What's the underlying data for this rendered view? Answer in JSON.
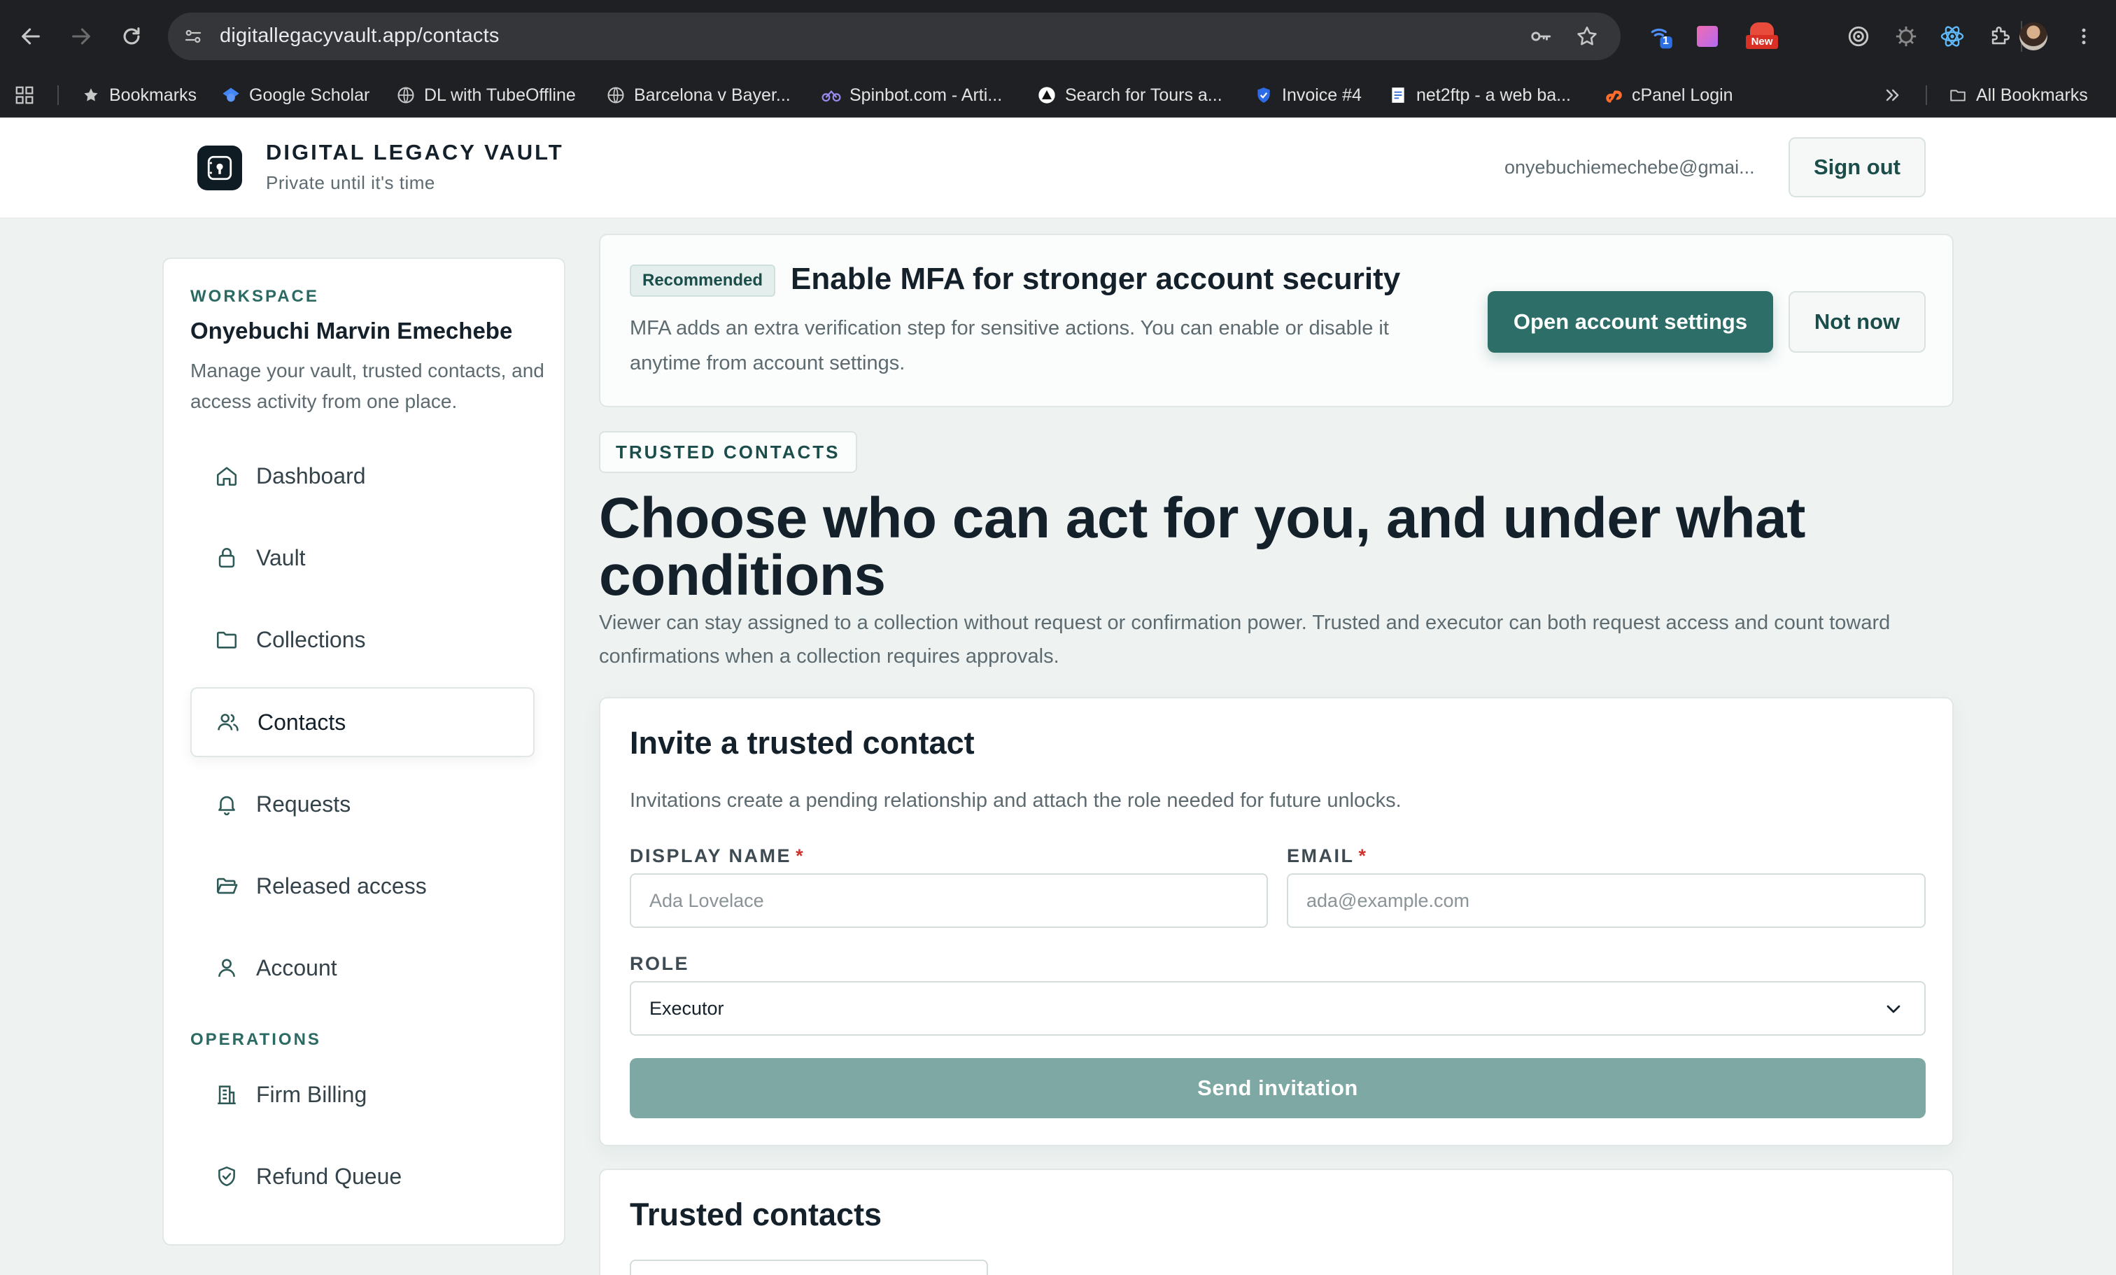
{
  "browser": {
    "url": "digitallegacyvault.app/contacts",
    "ext_badge_count": "1",
    "ext_new_label": "New",
    "bookmarks": [
      {
        "label": "Bookmarks",
        "icon": "star-icon"
      },
      {
        "label": "Google Scholar",
        "icon": "scholar-icon"
      },
      {
        "label": "DL with TubeOffline",
        "icon": "globe-icon"
      },
      {
        "label": "Barcelona v Bayer...",
        "icon": "globe-icon"
      },
      {
        "label": "Spinbot.com - Arti...",
        "icon": "spinbot-icon"
      },
      {
        "label": "Search for Tours a...",
        "icon": "tours-icon"
      },
      {
        "label": "Invoice #4",
        "icon": "shield-icon"
      },
      {
        "label": "net2ftp - a web ba...",
        "icon": "page-icon"
      },
      {
        "label": "cPanel Login",
        "icon": "cpanel-icon"
      }
    ],
    "all_bookmarks_label": "All Bookmarks"
  },
  "header": {
    "brand": "DIGITAL LEGACY VAULT",
    "tagline": "Private until it's time",
    "user_email": "onyebuchiemechebe@gmai...",
    "sign_out_label": "Sign out"
  },
  "sidebar": {
    "workspace_label": "WORKSPACE",
    "workspace_name": "Onyebuchi Marvin Emechebe",
    "workspace_desc": "Manage your vault, trusted contacts, and access activity from one place.",
    "items": [
      {
        "label": "Dashboard",
        "icon": "home-icon"
      },
      {
        "label": "Vault",
        "icon": "lock-icon"
      },
      {
        "label": "Collections",
        "icon": "folder-icon"
      },
      {
        "label": "Contacts",
        "icon": "users-icon",
        "active": true
      },
      {
        "label": "Requests",
        "icon": "bell-icon"
      },
      {
        "label": "Released access",
        "icon": "folder-open-icon"
      },
      {
        "label": "Account",
        "icon": "user-icon"
      }
    ],
    "operations_label": "OPERATIONS",
    "ops_items": [
      {
        "label": "Firm Billing",
        "icon": "building-icon"
      },
      {
        "label": "Refund Queue",
        "icon": "shield-check-icon"
      }
    ]
  },
  "mfa_banner": {
    "badge": "Recommended",
    "title": "Enable MFA for stronger account security",
    "desc": "MFA adds an extra verification step for sensitive actions. You can enable or disable it anytime from account settings.",
    "primary_label": "Open account settings",
    "secondary_label": "Not now"
  },
  "page": {
    "section_pill": "TRUSTED CONTACTS",
    "title": "Choose who can act for you, and under what conditions",
    "desc": "Viewer can stay assigned to a collection without request or confirmation power. Trusted and executor can both request access and count toward confirmations when a collection requires approvals."
  },
  "invite": {
    "title": "Invite a trusted contact",
    "desc": "Invitations create a pending relationship and attach the role needed for future unlocks.",
    "display_name_label": "DISPLAY NAME",
    "display_name_value": "",
    "display_name_placeholder": "Ada Lovelace",
    "email_label": "EMAIL",
    "email_value": "",
    "email_placeholder": "ada@example.com",
    "required_mark": "*",
    "role_label": "ROLE",
    "role_value": "Executor",
    "send_label": "Send invitation"
  },
  "contacts": {
    "title": "Trusted contacts"
  },
  "colors": {
    "accent": "#2d6f68",
    "accent_disabled": "#7ea8a3",
    "required": "#d0342c"
  }
}
